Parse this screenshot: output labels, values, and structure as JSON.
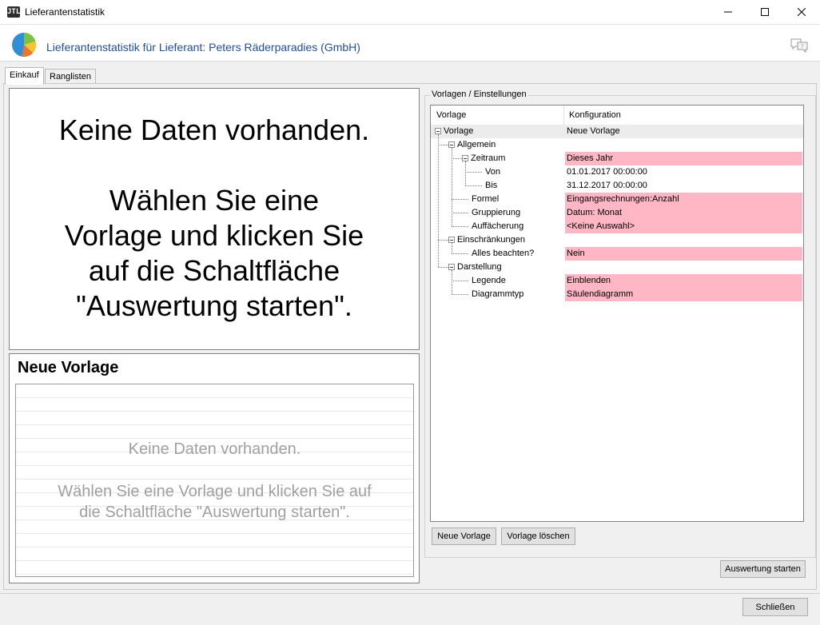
{
  "window": {
    "title": "Lieferantenstatistik",
    "app_icon": "jtl-logo-icon",
    "controls": [
      "minimize-icon",
      "maximize-icon",
      "close-icon"
    ]
  },
  "header": {
    "title": "Lieferantenstatistik für Lieferant: Peters Räderparadies (GmbH)",
    "logo_icon": "pie-chart-icon",
    "help_icon": "chat-help-icon"
  },
  "tabs": [
    {
      "label": "Einkauf",
      "active": true
    },
    {
      "label": "Ranglisten",
      "active": false
    }
  ],
  "main_message": {
    "line1": "Keine Daten vorhanden.",
    "line2": "Wählen Sie eine\nVorlage und klicken Sie\nauf die Schaltfläche\n\"Auswertung starten\"."
  },
  "vorlage_panel": {
    "heading": "Neue Vorlage",
    "msg1": "Keine Daten vorhanden.",
    "msg2": "Wählen Sie eine Vorlage und klicken Sie auf\ndie Schaltfläche \"Auswertung starten\"."
  },
  "settings": {
    "group_title": "Vorlagen / Einstellungen",
    "columns": [
      "Vorlage",
      "Konfiguration"
    ],
    "rows": [
      {
        "label": "Vorlage",
        "value": "Neue Vorlage",
        "level": 0,
        "expandable": true,
        "required": false
      },
      {
        "label": "Allgemein",
        "value": "",
        "level": 1,
        "expandable": true,
        "required": false
      },
      {
        "label": "Zeitraum",
        "value": "Dieses Jahr",
        "level": 2,
        "expandable": true,
        "required": true
      },
      {
        "label": "Von",
        "value": "01.01.2017 00:00:00",
        "level": 3,
        "expandable": false,
        "required": false
      },
      {
        "label": "Bis",
        "value": "31.12.2017 00:00:00",
        "level": 3,
        "expandable": false,
        "required": false
      },
      {
        "label": "Formel",
        "value": "Eingangsrechnungen:Anzahl",
        "level": 2,
        "expandable": false,
        "required": true
      },
      {
        "label": "Gruppierung",
        "value": "Datum: Monat",
        "level": 2,
        "expandable": false,
        "required": true
      },
      {
        "label": "Auffächerung",
        "value": "<Keine Auswahl>",
        "level": 2,
        "expandable": false,
        "required": true
      },
      {
        "label": "Einschränkungen",
        "value": "",
        "level": 1,
        "expandable": true,
        "required": false
      },
      {
        "label": "Alles beachten?",
        "value": "Nein",
        "level": 2,
        "expandable": false,
        "required": true
      },
      {
        "label": "Darstellung",
        "value": "",
        "level": 1,
        "expandable": true,
        "required": false
      },
      {
        "label": "Legende",
        "value": "Einblenden",
        "level": 2,
        "expandable": false,
        "required": true
      },
      {
        "label": "Diagrammtyp",
        "value": "Säulendiagramm",
        "level": 2,
        "expandable": false,
        "required": true
      }
    ],
    "required_color": "#ffb7c5"
  },
  "buttons": {
    "neue_vorlage": "Neue Vorlage",
    "vorlage_loeschen": "Vorlage löschen",
    "auswertung_starten": "Auswertung starten",
    "schliessen": "Schließen"
  }
}
